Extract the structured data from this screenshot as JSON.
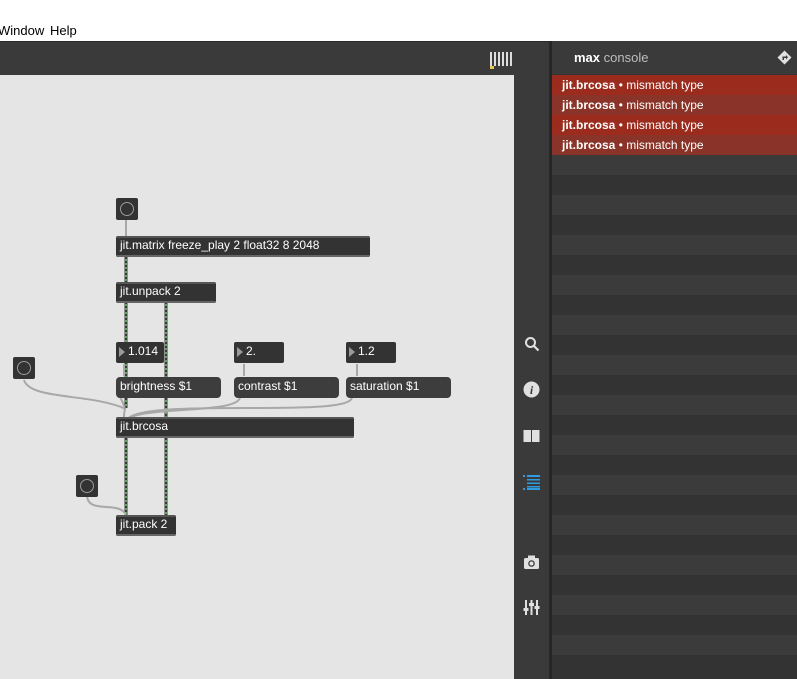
{
  "menu": {
    "window": "Window",
    "help": "Help"
  },
  "console": {
    "title_bold": "max",
    "title_rest": "console",
    "messages": [
      {
        "object": "jit.brcosa",
        "sep": " • ",
        "text": "mismatch type"
      },
      {
        "object": "jit.brcosa",
        "sep": " • ",
        "text": "mismatch type"
      },
      {
        "object": "jit.brcosa",
        "sep": " • ",
        "text": "mismatch type"
      },
      {
        "object": "jit.brcosa",
        "sep": " • ",
        "text": "mismatch type"
      }
    ]
  },
  "patch": {
    "matrix": "jit.matrix freeze_play 2 float32 8 2048",
    "unpack": "jit.unpack 2",
    "num_brightness": "1.014",
    "num_contrast": "2.",
    "num_saturation": "1.2",
    "msg_brightness": "brightness $1",
    "msg_contrast": "contrast $1",
    "msg_saturation": "saturation $1",
    "brcosa": "jit.brcosa",
    "pack": "jit.pack 2"
  },
  "toolbar": {
    "icons": [
      "search-icon",
      "info-icon",
      "reference-icon",
      "console-icon",
      "snapshot-icon",
      "mixer-icon"
    ]
  },
  "colors": {
    "error_row": "#9a2b1d",
    "accent_blue": "#2f9be0",
    "patch_bg": "#e5e5e5",
    "object_bg": "#333333"
  }
}
